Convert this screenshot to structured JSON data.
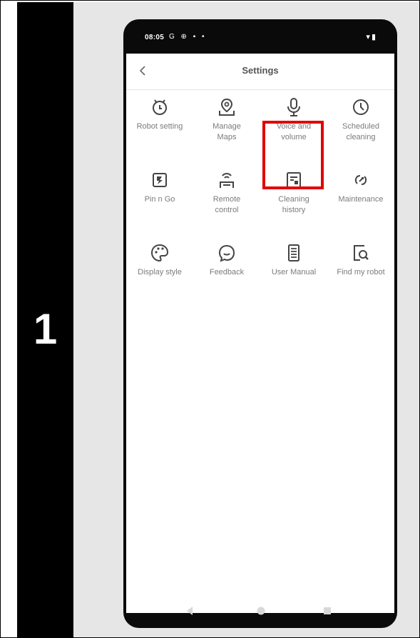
{
  "step": {
    "number": "1"
  },
  "status_bar": {
    "time": "08:05",
    "left_icons": "G ⊕ ▪ •",
    "right_icons": "▾▮"
  },
  "app_bar": {
    "title": "Settings",
    "back_icon": "chevron-left-icon"
  },
  "settings_items": [
    {
      "label": "Robot setting",
      "icon": "robot-setting-icon"
    },
    {
      "label": "Manage\nMaps",
      "icon": "map-pin-icon"
    },
    {
      "label": "Voice and\nvolume",
      "icon": "microphone-icon",
      "highlighted": true
    },
    {
      "label": "Scheduled\ncleaning",
      "icon": "clock-icon"
    },
    {
      "label": "Pin n Go",
      "icon": "pin-n-go-icon"
    },
    {
      "label": "Remote\ncontrol",
      "icon": "remote-control-icon"
    },
    {
      "label": "Cleaning\nhistory",
      "icon": "cleaning-history-icon"
    },
    {
      "label": "Maintenance",
      "icon": "maintenance-icon"
    },
    {
      "label": "Display style",
      "icon": "palette-icon"
    },
    {
      "label": "Feedback",
      "icon": "feedback-icon"
    },
    {
      "label": "User Manual",
      "icon": "manual-icon"
    },
    {
      "label": "Find my robot",
      "icon": "find-robot-icon"
    }
  ],
  "highlight_color": "#e10000",
  "nav_bar": {
    "back_icon": "triangle-back-icon",
    "home_icon": "circle-home-icon",
    "recent_icon": "square-recent-icon"
  }
}
